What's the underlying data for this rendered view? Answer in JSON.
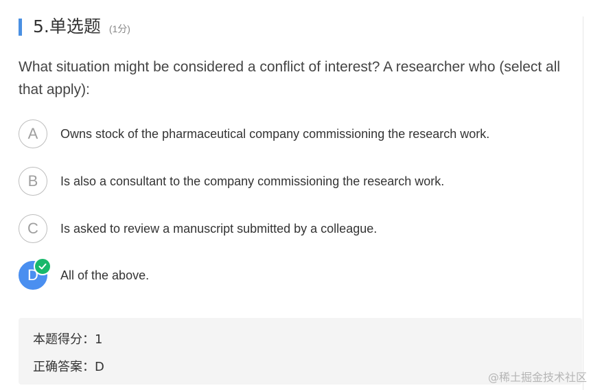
{
  "question": {
    "title": "5.单选题",
    "score": "(1分)",
    "stem": "What situation might be considered a conflict of interest? A researcher who (select all that apply):"
  },
  "options": [
    {
      "letter": "A",
      "text": "Owns stock of the pharmaceutical company commissioning the research work.",
      "selected": false
    },
    {
      "letter": "B",
      "text": "Is also a consultant to the company commissioning the research work.",
      "selected": false
    },
    {
      "letter": "C",
      "text": "Is asked to review a manuscript submitted by a colleague.",
      "selected": false
    },
    {
      "letter": "D",
      "text": "All of the above.",
      "selected": true
    }
  ],
  "result": {
    "score_line": "本题得分：1",
    "answer_line": "正确答案：D"
  },
  "watermark": "@稀土掘金技术社区",
  "colors": {
    "accent": "#4a90e2",
    "selected": "#4a8ff0",
    "correct_badge": "#18b86b",
    "result_bg": "#f4f4f4"
  },
  "icons": {
    "correct": "check-icon"
  }
}
